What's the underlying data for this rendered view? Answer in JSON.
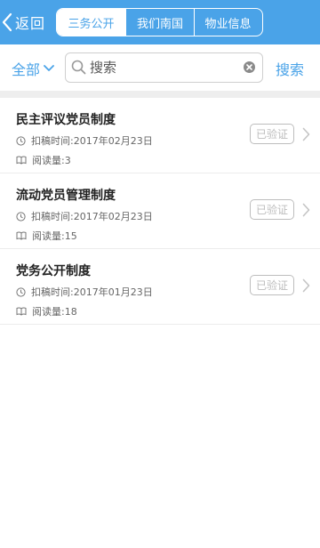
{
  "header": {
    "back_label": "返回",
    "tabs": [
      {
        "label": "三务公开",
        "active": true
      },
      {
        "label": "我们南国",
        "active": false
      },
      {
        "label": "物业信息",
        "active": false
      }
    ]
  },
  "searchbar": {
    "filter_label": "全部",
    "placeholder": "搜索",
    "search_button": "搜索"
  },
  "items": [
    {
      "title": "民主评议党员制度",
      "date": "扣稿时间:2017年02月23日",
      "reads": "阅读量:3",
      "status": "已验证"
    },
    {
      "title": "流动党员管理制度",
      "date": "扣稿时间:2017年02月23日",
      "reads": "阅读量:15",
      "status": "已验证"
    },
    {
      "title": "党务公开制度",
      "date": "扣稿时间:2017年01月23日",
      "reads": "阅读量:18",
      "status": "已验证"
    }
  ],
  "colors": {
    "accent": "#4aa3e8",
    "badge": "#bdbdbd",
    "band": "#eeeeee"
  }
}
